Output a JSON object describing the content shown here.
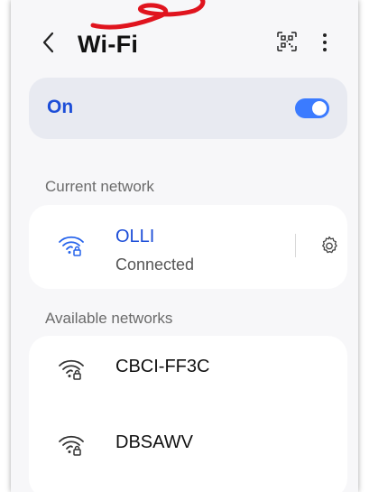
{
  "header": {
    "title": "Wi-Fi",
    "back_icon": "chevron-left-icon",
    "qr_icon": "qr-code-icon",
    "more_icon": "more-vertical-icon"
  },
  "wifi_toggle": {
    "label": "On",
    "state": "on",
    "accent_color": "#3b7bff"
  },
  "current_network": {
    "section_label": "Current network",
    "name": "OLLI",
    "status": "Connected",
    "icon": "wifi-lock-icon",
    "settings_icon": "gear-icon"
  },
  "available_networks": {
    "section_label": "Available networks",
    "items": [
      {
        "name": "CBCI-FF3C",
        "icon": "wifi-lock-icon"
      },
      {
        "name": "DBSAWV",
        "icon": "wifi-lock-icon"
      }
    ]
  },
  "colors": {
    "accent_text": "#1d4ed8",
    "annotation_red": "#e0141e",
    "background": "#f7f7f9"
  }
}
